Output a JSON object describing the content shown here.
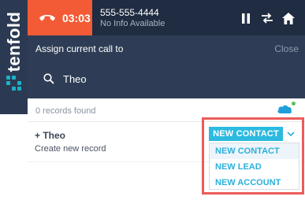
{
  "brand": {
    "name": "tenfold",
    "mark_color": "#1bb1c8"
  },
  "call": {
    "timer": "03:03",
    "caller_number": "555-555-4444",
    "caller_info": "No Info Available",
    "hangup_icon": "phone-hangup-icon",
    "accent": "#f25b35"
  },
  "controls": [
    {
      "name": "pause-icon"
    },
    {
      "name": "transfer-icon"
    },
    {
      "name": "home-icon"
    }
  ],
  "assign": {
    "title": "Assign current call to",
    "close_label": "Close"
  },
  "search": {
    "value": "Theo",
    "placeholder": ""
  },
  "results": {
    "count_text": "0 records found",
    "crm_icon": "salesforce-icon",
    "status_color": "#56c15b"
  },
  "record": {
    "name": "+ Theo",
    "subtitle": "Create new record"
  },
  "create_select": {
    "selected": "NEW CONTACT",
    "options": [
      "NEW CONTACT",
      "NEW LEAD",
      "NEW ACCOUNT"
    ],
    "button_color": "#2bbae0"
  },
  "highlight_color": "#ec5b5b"
}
